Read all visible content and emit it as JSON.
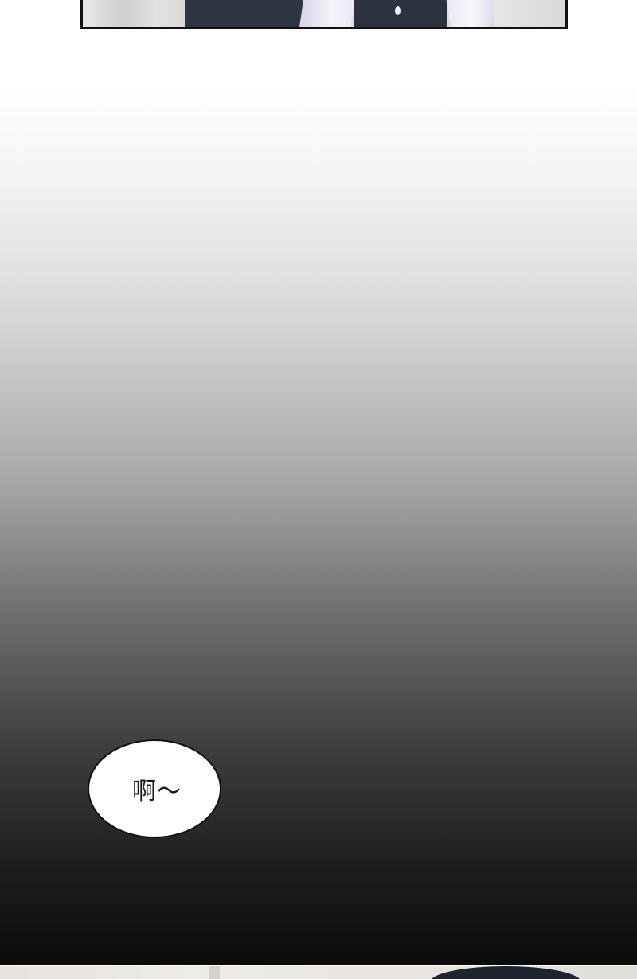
{
  "panels": {
    "top": {
      "description_name": "top-comic-panel"
    },
    "bottom": {
      "description_name": "bottom-comic-panel"
    }
  },
  "bubble": {
    "text": "啊～"
  },
  "colors": {
    "gradient_top": "#ffffff",
    "gradient_bottom": "#0b0b0b",
    "bubble_border": "#111111",
    "bubble_fill": "#ffffff",
    "jacket": "#2d3444"
  }
}
